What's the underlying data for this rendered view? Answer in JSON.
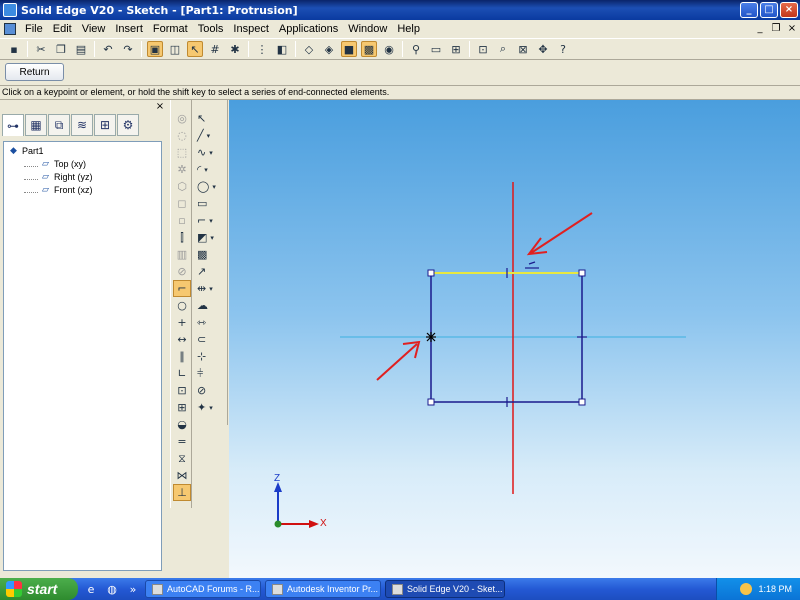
{
  "window": {
    "title": "Solid Edge V20 - Sketch - [Part1: Protrusion]",
    "minimize": "_",
    "maximize": "□",
    "close": "×",
    "doc_minimize": "_",
    "doc_restore": "❐",
    "doc_close": "×"
  },
  "menu": [
    "File",
    "Edit",
    "View",
    "Insert",
    "Format",
    "Tools",
    "Inspect",
    "Applications",
    "Window",
    "Help"
  ],
  "ribbon": {
    "return_label": "Return"
  },
  "prompt": "Click on a keypoint or element, or hold the shift key to select a series of end-connected elements.",
  "panel": {
    "close": "×",
    "tree": {
      "root": "Part1",
      "children": [
        "Top (xy)",
        "Right (yz)",
        "Front (xz)"
      ]
    }
  },
  "triad": {
    "z_label": "Z",
    "x_label": "X"
  },
  "taskbar": {
    "start_label": "start",
    "tasks": [
      "AutoCAD Forums - R...",
      "Autodesk Inventor Pr...",
      "Solid Edge V20 - Sket..."
    ],
    "clock": "1:18 PM"
  },
  "colors": {
    "sketch_lines": "#1a1a8c",
    "selected_line": "#e8e840",
    "vertical_axis": "#e01818",
    "horizontal_axis": "#3cb0e0",
    "annotation_arrows": "#e02020",
    "triad_z": "#1a3cc8",
    "triad_x": "#d01010",
    "title_bar": "#0a246a"
  }
}
